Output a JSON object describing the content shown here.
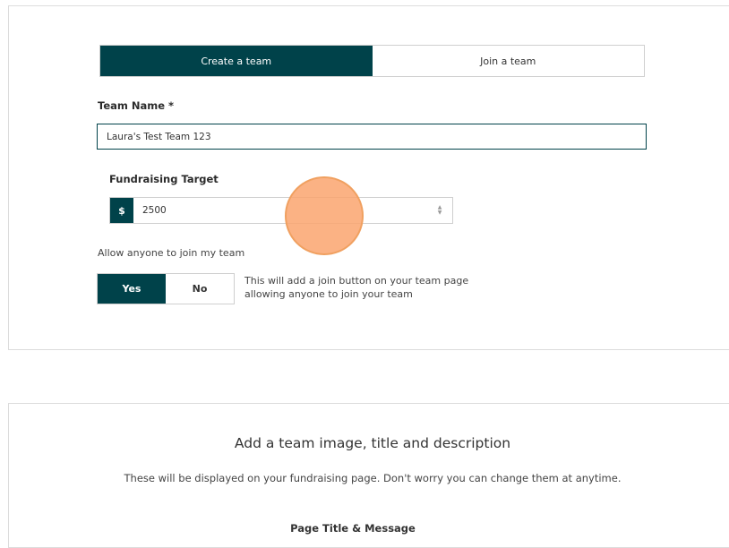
{
  "colors": {
    "brand": "#00424a",
    "accent_touch": "#f6ad78"
  },
  "team_form": {
    "tabs": [
      {
        "label": "Create a team",
        "active": true
      },
      {
        "label": "Join a team",
        "active": false
      }
    ],
    "team_name": {
      "label": "Team Name *",
      "value": "Laura's Test Team 123"
    },
    "fundraising": {
      "label": "Fundraising Target",
      "currency": "$",
      "value": "2500"
    },
    "allow_join": {
      "label": "Allow anyone to join my team",
      "yes_label": "Yes",
      "no_label": "No",
      "selected": "Yes",
      "helper": "This will add a join button on your team page allowing anyone to join your team"
    }
  },
  "image_section": {
    "title": "Add a team image, title and description",
    "subtitle": "These will be displayed on your fundraising page. Don't worry you can change them at anytime.",
    "next_label": "Page Title & Message"
  }
}
